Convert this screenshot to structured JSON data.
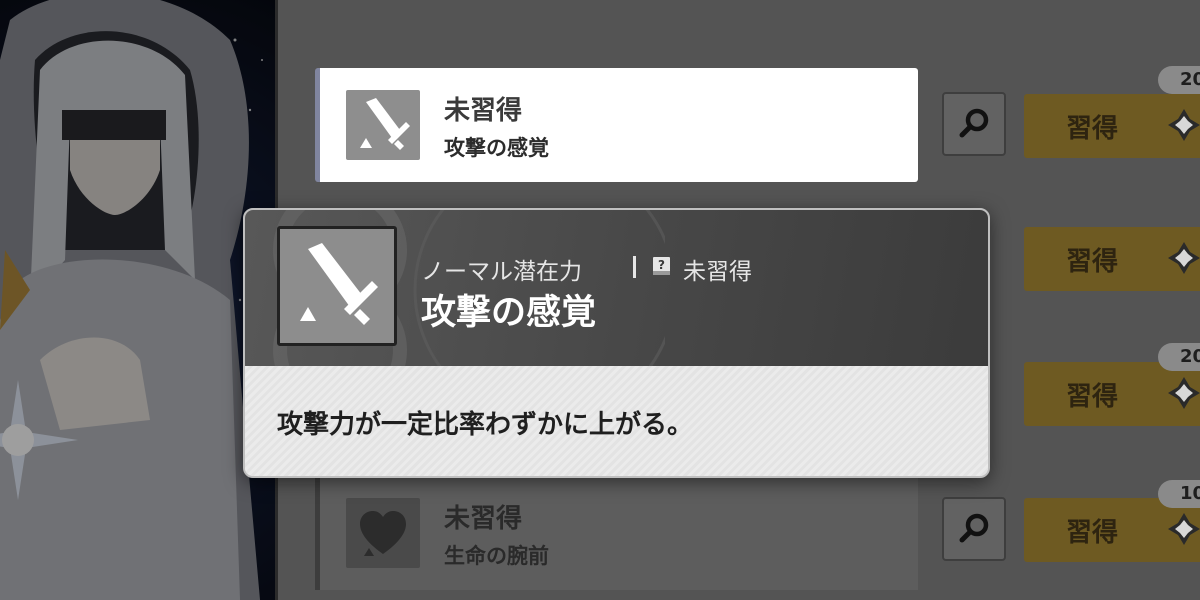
{
  "skills": [
    {
      "status": "未習得",
      "name": "攻撃の感覚",
      "icon": "sword-icon",
      "learn_label": "習得",
      "cost": "20",
      "selected": true
    },
    {
      "status": "",
      "name": "",
      "icon": "",
      "learn_label": "習得",
      "cost": "",
      "selected": false
    },
    {
      "status": "",
      "name": "",
      "icon": "",
      "learn_label": "習得",
      "cost": "20",
      "selected": false
    },
    {
      "status": "未習得",
      "name": "生命の腕前",
      "icon": "heart-icon",
      "learn_label": "習得",
      "cost": "10",
      "selected": false
    }
  ],
  "tooltip": {
    "category": "ノーマル潜在力",
    "status": "未習得",
    "title": "攻撃の感覚",
    "description": "攻撃力が一定比率わずかに上がる。",
    "icon": "sword-icon",
    "status_icon": "book-question-icon"
  },
  "colors": {
    "learn_button": "#6e5a22",
    "selected_accent": "#80859f",
    "panel_bg": "#545454"
  }
}
